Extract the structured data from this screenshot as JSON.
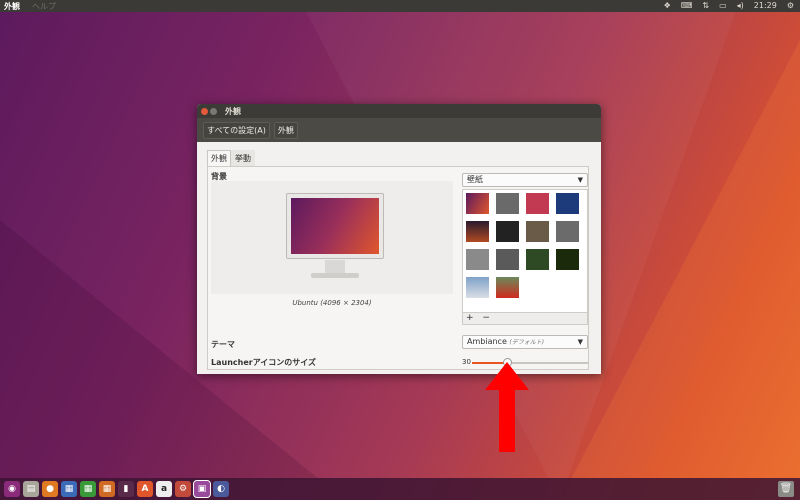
{
  "top_panel": {
    "app_menu": "外観",
    "help_menu": "ヘルプ",
    "time": "21:29"
  },
  "window": {
    "title": "外観",
    "toolbar": {
      "all_settings": "すべての設定(A)",
      "current": "外観"
    },
    "tabs": [
      {
        "label": "外観",
        "active": true
      },
      {
        "label": "挙動",
        "active": false
      }
    ],
    "background_label": "背景",
    "wallpaper_name": "Ubuntu (4096 × 2304)",
    "wallpaper_source": "壁紙",
    "add_button": "+",
    "remove_button": "−",
    "theme_label": "テーマ",
    "theme_value": "Ambiance",
    "theme_default": "(デフォルト)",
    "launcher_size_label": "Launcherアイコンのサイズ",
    "launcher_size_value": "30",
    "launcher_size_fraction": 0.3
  },
  "colors": {
    "accent": "#e95420",
    "arrow": "#ff0000"
  }
}
